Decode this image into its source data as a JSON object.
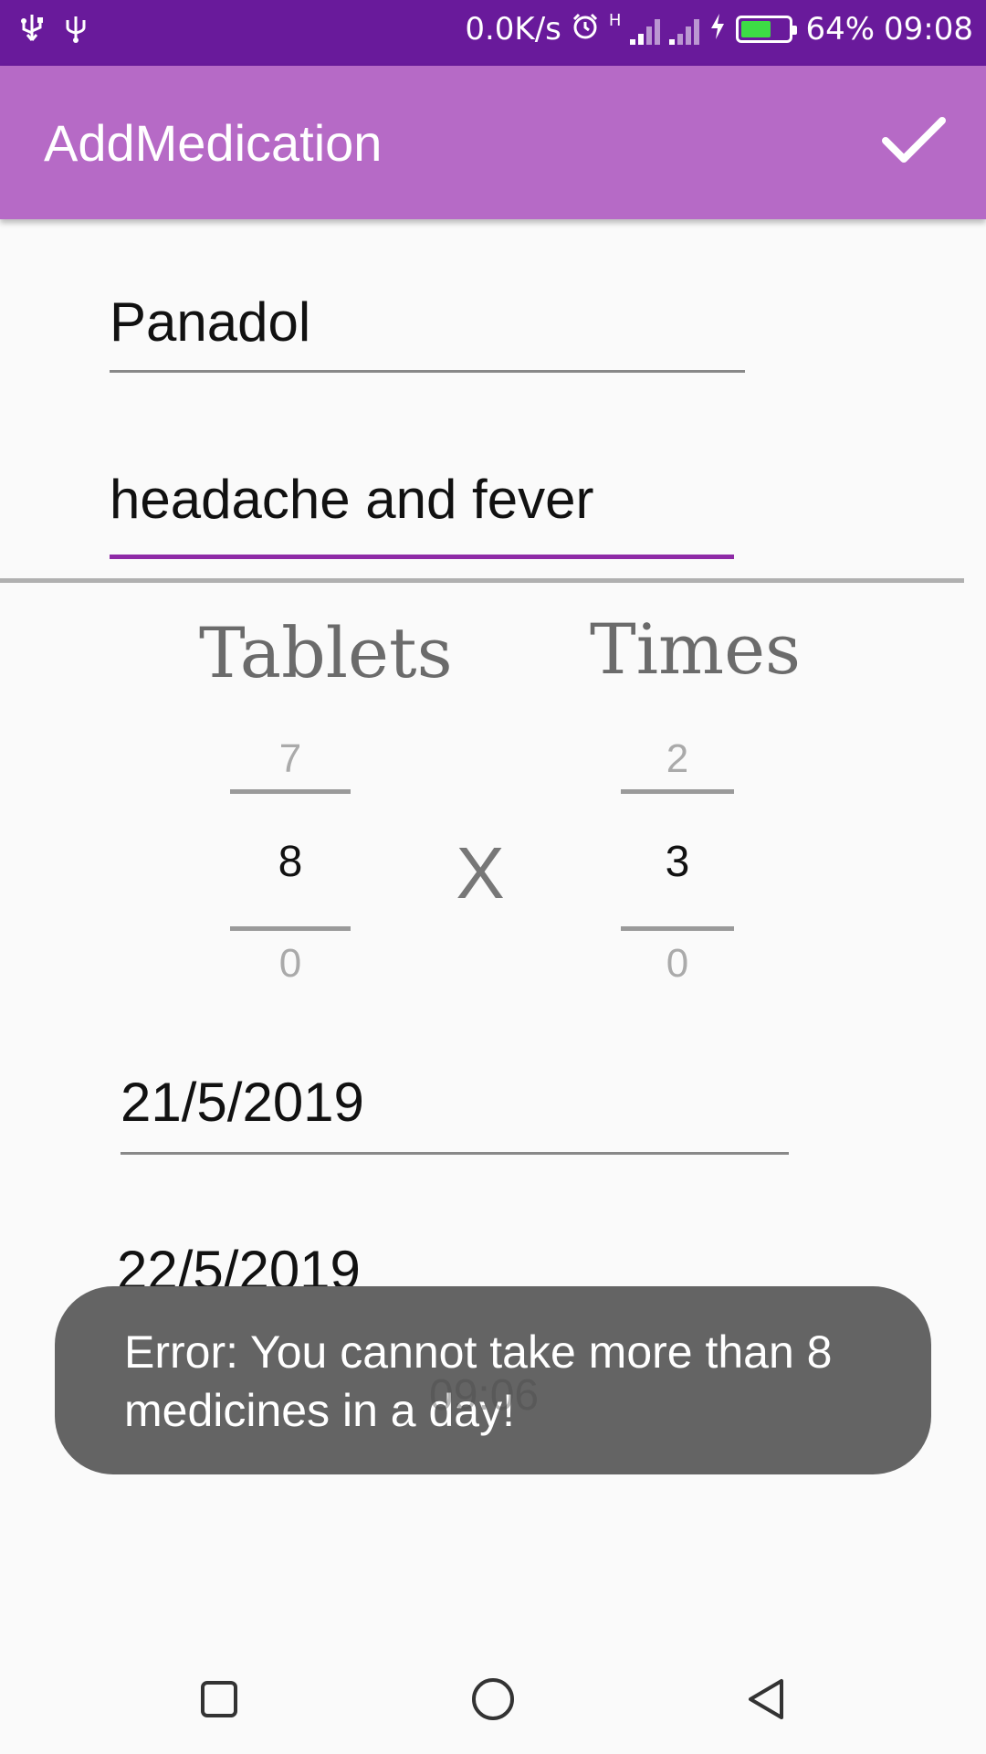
{
  "status_bar": {
    "left_icons": [
      "usb-icon",
      "usb-debug-icon"
    ],
    "net_speed": "0.0K/s",
    "network_type": "H",
    "battery_level": 64,
    "battery_text": "64%",
    "time": "09:08"
  },
  "app_bar": {
    "title": "AddMedication",
    "confirm_icon": "check-icon"
  },
  "form": {
    "medicine_name": "Panadol",
    "reason": "headache and fever",
    "start_date": "21/5/2019",
    "end_date": "22/5/2019",
    "time_hidden": "09:06"
  },
  "dosage": {
    "tablets_label": "Tablets",
    "times_label": "Times",
    "multiply_symbol": "X",
    "tablets_prev": "7",
    "tablets_current": "8",
    "tablets_next": "0",
    "times_prev": "2",
    "times_current": "3",
    "times_next": "0"
  },
  "toast": {
    "message": " Error: You cannot take more than 8 medicines in a day!"
  },
  "nav_bar": {
    "items": [
      "recents-icon",
      "home-icon",
      "back-icon"
    ]
  },
  "colors": {
    "status_bar": "#691a9b",
    "app_bar": "#b66ac6",
    "focus_underline": "#8e2aa6",
    "toast_bg": "#646464",
    "battery_fill": "#3ddc45"
  }
}
